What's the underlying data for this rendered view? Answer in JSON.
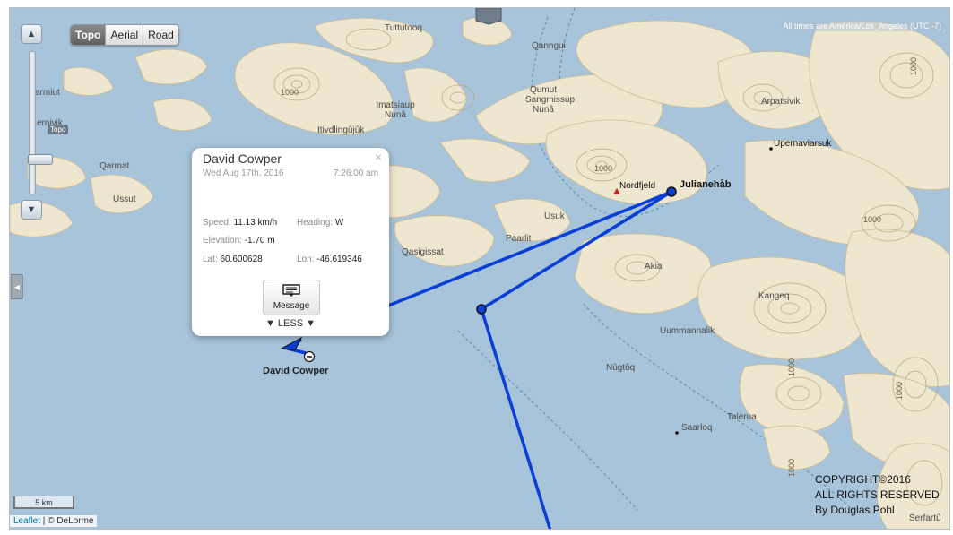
{
  "map": {
    "timezone_note": "All times are America/Los_Angeles (UTC -7)",
    "map_types": [
      "Topo",
      "Aerial",
      "Road"
    ],
    "active_map_type": "Topo",
    "zoom_tooltip": "Topo",
    "scale_label": "5 km",
    "attribution_link": "Leaflet",
    "attribution_rest": " | © DeLorme",
    "copyright_lines": [
      "COPYRIGHT©2016",
      "ALL RIGHTS RESERVED",
      "By Douglas Pohl"
    ],
    "track_color": "#0a3fd6",
    "water_color": "#a8c4da",
    "land_color": "#efe6cf"
  },
  "places": {
    "julianehab": "Julianehåb",
    "nordfjeld": "Nordfjeld",
    "upernaviarsuk": "Upernaviarsuk",
    "saarloq": "Saarloq",
    "tuttutooq": "Tuttutooq",
    "qanngui": "Qanngui",
    "qumut_1": "Qumut",
    "qumut_2": "Sangmissup",
    "qumut_3": "Nunâ",
    "imatsiaup_1": "Imatsiaup",
    "imatsiaup_2": "Nunâ",
    "itivdlingujuk": "Itivdlingûjûk",
    "qarmat": "Qarmat",
    "ussut": "Ussut",
    "qasigissat": "Qasigissat",
    "paarlit": "Paarlit",
    "usuk": "Usuk",
    "akia": "Akia",
    "kangeq": "Kangeq",
    "uummannalik": "Uummannalik",
    "nugtoq": "Nûgtôq",
    "talerua": "Talerua",
    "arpatsivik": "Arpatsivik",
    "armiut": "armiut",
    "ernivik": "ernivik",
    "serfartu": "Serfartû",
    "elev": "1000"
  },
  "popup": {
    "name": "David Cowper",
    "date": "Wed Aug 17th, 2016",
    "time": "7:26:00 am",
    "speed_label": "Speed:",
    "speed": "11.13 km/h",
    "heading_label": "Heading:",
    "heading": "W",
    "elevation_label": "Elevation:",
    "elevation": "-1.70 m",
    "lat_label": "Lat:",
    "lat": "60.600628",
    "lon_label": "Lon:",
    "lon": "-46.619346",
    "message_label": "Message",
    "less_label": "▼ LESS ▼",
    "close": "×"
  },
  "tracker_label": "David Cowper"
}
